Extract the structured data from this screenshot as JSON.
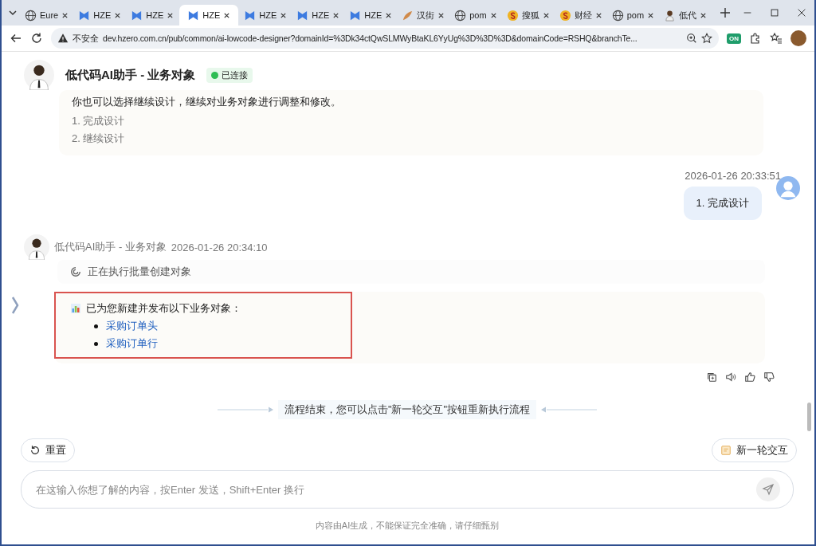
{
  "browser": {
    "tabs": [
      {
        "label": "Eure",
        "kind": "globe",
        "selected": false
      },
      {
        "label": "HZE",
        "kind": "flag",
        "selected": false
      },
      {
        "label": "HZE",
        "kind": "flag",
        "selected": false
      },
      {
        "label": "HZE",
        "kind": "flag",
        "selected": true
      },
      {
        "label": "HZE",
        "kind": "flag",
        "selected": false
      },
      {
        "label": "HZE",
        "kind": "flag",
        "selected": false
      },
      {
        "label": "HZE",
        "kind": "flag",
        "selected": false
      },
      {
        "label": "汉街",
        "kind": "leaf",
        "selected": false
      },
      {
        "label": "pom",
        "kind": "globe",
        "selected": false
      },
      {
        "label": "搜狐",
        "kind": "coin",
        "selected": false
      },
      {
        "label": "财经",
        "kind": "coin",
        "selected": false
      },
      {
        "label": "pom",
        "kind": "globe",
        "selected": false
      },
      {
        "label": "低代",
        "kind": "person",
        "selected": false
      }
    ],
    "security_label": "不安全",
    "url": "dev.hzero.com.cn/pub/common/ai-lowcode-designer?domainId=%3Dk34ctQwSLMWyBtaKL6YyUg%3D%3D%3D&domainCode=RSHQ&branchTe...",
    "extension_badge": "ON"
  },
  "header": {
    "title": "低代码AI助手 - 业务对象",
    "status": "已连接",
    "connected": true
  },
  "messages": [
    {
      "kind": "bot_card",
      "text": "你也可以选择继续设计，继续对业务对象进行调整和修改。",
      "options": [
        "1. 完成设计",
        "2. 继续设计"
      ]
    },
    {
      "kind": "user",
      "time": "2026-01-26 20:33:51",
      "text": "1. 完成设计"
    },
    {
      "kind": "bot",
      "sender": "低代码AI助手 - 业务对象",
      "time": "2026-01-26 20:34:10",
      "step": "正在执行批量创建对象",
      "result_title": "已为您新建并发布以下业务对象：",
      "links": [
        "采购订单头",
        "采购订单行"
      ],
      "highlighted": true
    }
  ],
  "flow_end": "流程结束，您可以点击\"新一轮交互\"按钮重新执行流程",
  "reset_button": "重置",
  "new_round_button": "新一轮交互",
  "input": {
    "placeholder": "在这输入你想了解的内容，按Enter 发送，Shift+Enter 换行"
  },
  "disclaimer": "内容由AI生成，不能保证完全准确，请仔细甄别"
}
